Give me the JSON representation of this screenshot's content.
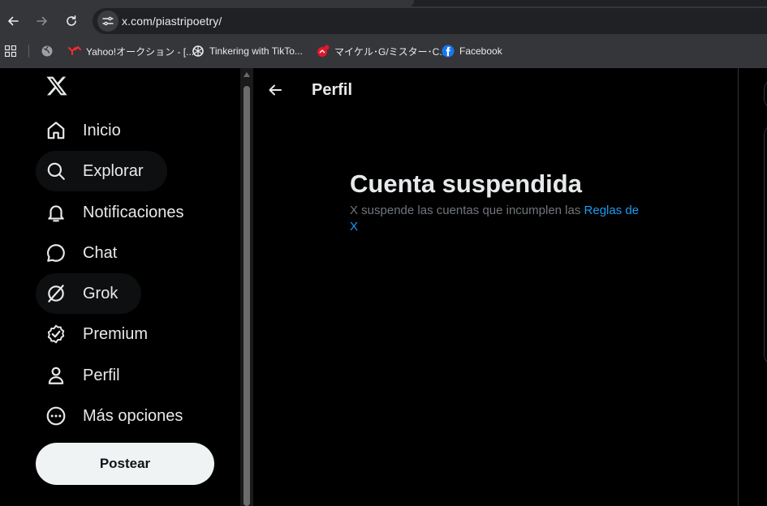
{
  "browser": {
    "url": "x.com/piastripoetry/",
    "bookmarks": [
      {
        "label": "Yahoo!オークション - [...",
        "icon": "yahoo-auction-icon"
      },
      {
        "label": "Tinkering with TikTo...",
        "icon": "openai-icon"
      },
      {
        "label": "マイケル･G/ミスター･C...",
        "icon": "red-favicon-icon"
      },
      {
        "label": "Facebook",
        "icon": "facebook-icon"
      }
    ]
  },
  "sidebar": {
    "items": [
      {
        "label": "Inicio",
        "icon": "home-icon"
      },
      {
        "label": "Explorar",
        "icon": "search-icon"
      },
      {
        "label": "Notificaciones",
        "icon": "bell-icon"
      },
      {
        "label": "Chat",
        "icon": "chat-bubble-icon"
      },
      {
        "label": "Grok",
        "icon": "grok-icon"
      },
      {
        "label": "Premium",
        "icon": "verified-badge-icon"
      },
      {
        "label": "Perfil",
        "icon": "person-icon"
      },
      {
        "label": "Más opciones",
        "icon": "more-circle-icon"
      }
    ],
    "post_label": "Postear"
  },
  "main": {
    "header_title": "Perfil",
    "suspended": {
      "title": "Cuenta suspendida",
      "message": "X suspende las cuentas que incumplen las ",
      "link": "Reglas de X"
    }
  },
  "colors": {
    "background": "#000000",
    "text": "#e7e9ea",
    "muted": "#71767b",
    "link": "#1d9bf0",
    "post_button": "#eff3f4"
  }
}
